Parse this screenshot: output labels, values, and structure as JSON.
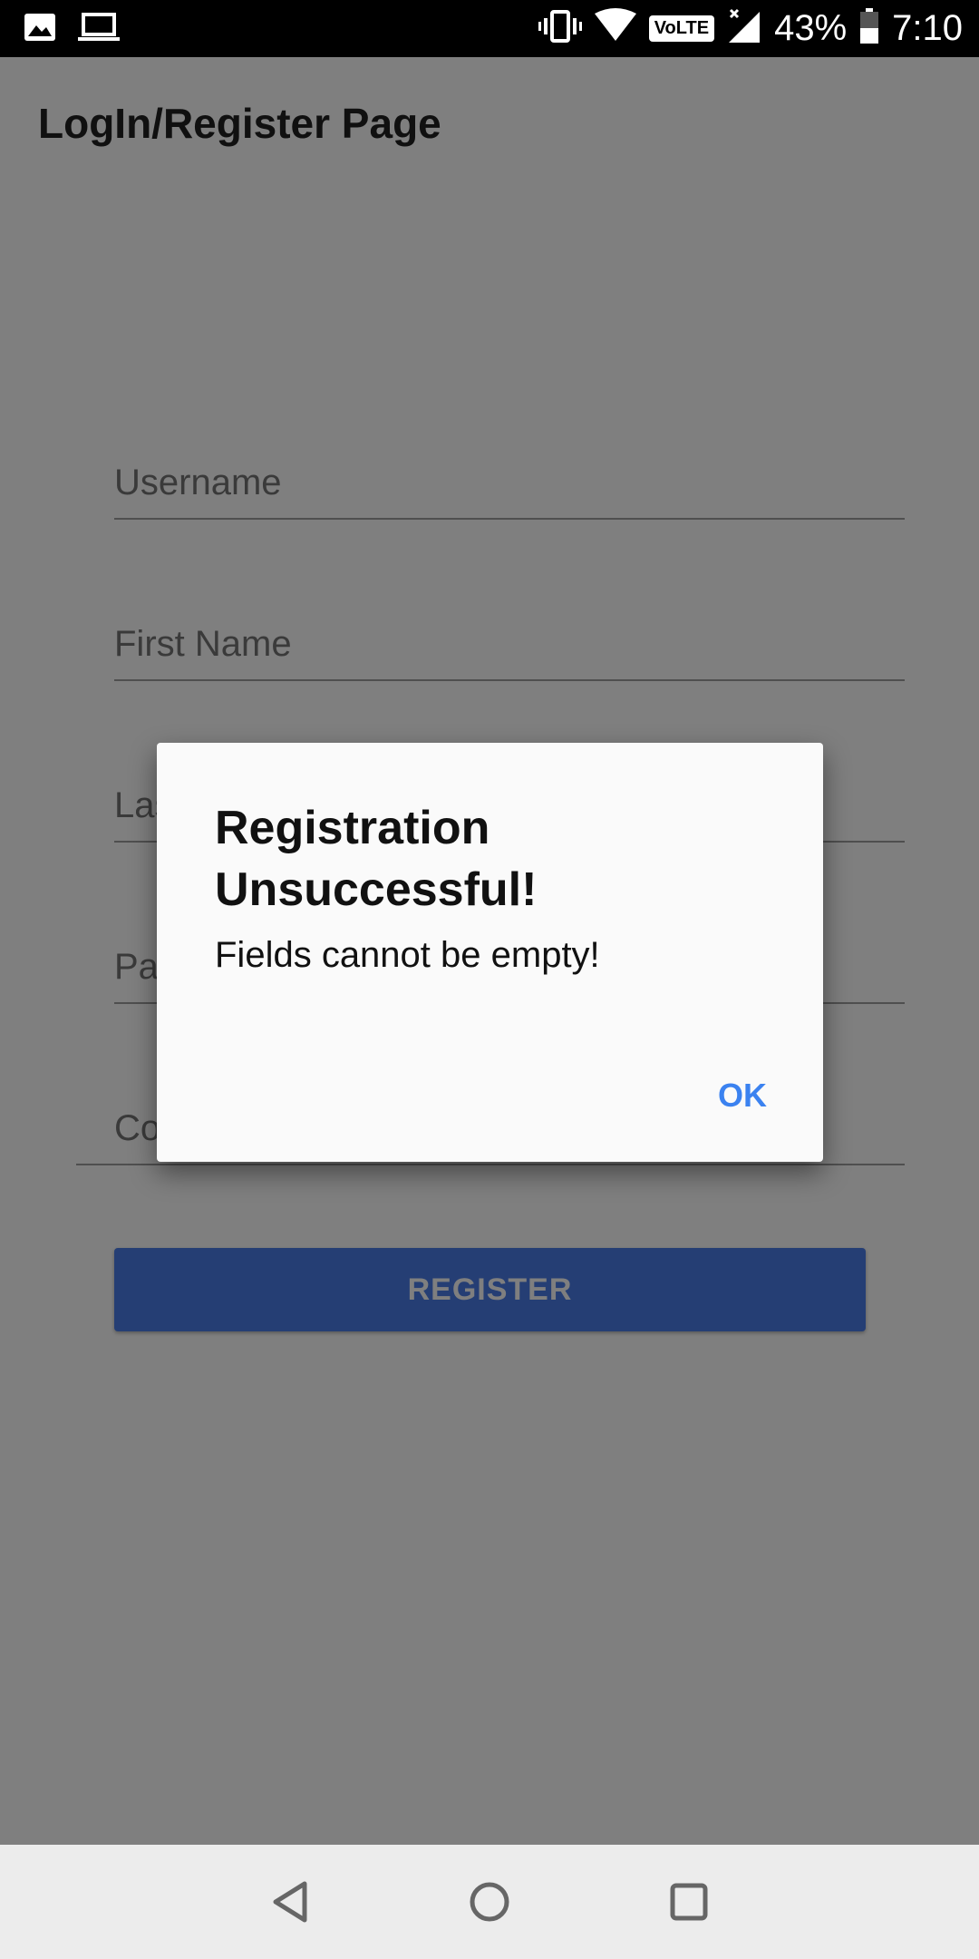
{
  "status_bar": {
    "battery": "43%",
    "time": "7:10",
    "network_badge": "VoLTE",
    "icons": [
      "image-icon",
      "laptop-icon",
      "vibrate-icon",
      "wifi-icon",
      "volte-icon",
      "signal-icon",
      "battery-icon"
    ]
  },
  "app_bar": {
    "title": "LogIn/Register Page"
  },
  "form": {
    "fields": [
      {
        "placeholder": "Username",
        "value": ""
      },
      {
        "placeholder": "First Name",
        "value": ""
      },
      {
        "placeholder": "Last Name",
        "value": ""
      },
      {
        "placeholder": "Password",
        "value": ""
      },
      {
        "placeholder": "Confirm Password",
        "value": ""
      }
    ],
    "register_label": "REGISTER"
  },
  "dialog": {
    "title": "Registration Unsuccessful!",
    "message": "Fields cannot be empty!",
    "ok_label": "OK"
  },
  "nav_bar": {
    "icons": [
      "back-icon",
      "home-icon",
      "recents-icon"
    ]
  },
  "colors": {
    "accent": "#3b82f0",
    "button": "#4a7de8",
    "scrim": "rgba(0,0,0,0.5)"
  }
}
